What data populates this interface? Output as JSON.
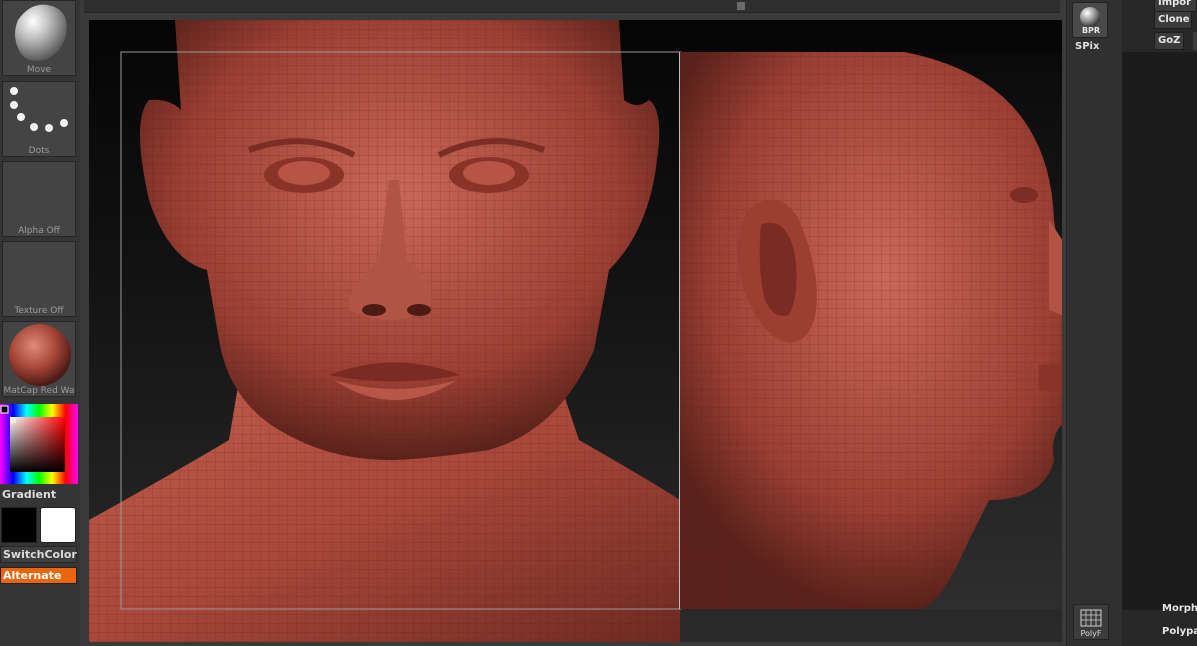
{
  "left_shelf": {
    "brush_label": "Move",
    "stroke_label": "Dots",
    "alpha_label": "Alpha  Off",
    "texture_label": "Texture  Off",
    "material_label": "MatCap  Red  Wa",
    "gradient_label": "Gradient",
    "switch_color_label": "SwitchColor",
    "alternate_label": "Alternate",
    "main_color": "#000000",
    "secondary_color": "#ffffff",
    "accent_color": "#e9660f"
  },
  "right_shelf": {
    "bpr_label": "BPR",
    "spix_label": "SPix",
    "polyf_label": "PolyF"
  },
  "tool_palette": {
    "import_label": "Impor",
    "clone_label": "Clone",
    "goz_label": "GoZ",
    "morph_label": "Morph",
    "polypaint_label": "Polypa"
  },
  "canvas": {
    "subject": "sculpted head, front and side view",
    "material_color": "#a8473a"
  }
}
